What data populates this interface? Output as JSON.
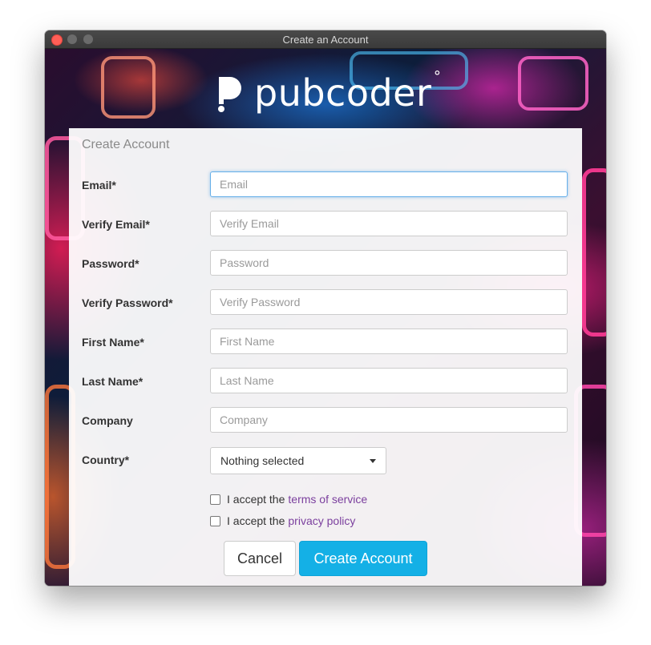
{
  "window": {
    "title": "Create an Account"
  },
  "logo": {
    "text": "pubcoder",
    "mark": "°"
  },
  "form": {
    "title": "Create Account",
    "fields": [
      {
        "label": "Email*",
        "placeholder": "Email"
      },
      {
        "label": "Verify Email*",
        "placeholder": "Verify Email"
      },
      {
        "label": "Password*",
        "placeholder": "Password"
      },
      {
        "label": "Verify Password*",
        "placeholder": "Verify Password"
      },
      {
        "label": "First Name*",
        "placeholder": "First Name"
      },
      {
        "label": "Last Name*",
        "placeholder": "Last Name"
      },
      {
        "label": "Company",
        "placeholder": "Company"
      }
    ],
    "country": {
      "label": "Country*",
      "selected": "Nothing selected"
    },
    "terms": {
      "prefix": "I accept the",
      "link": "terms of service",
      "checked": false
    },
    "privacy": {
      "prefix": "I accept the",
      "link": "privacy policy",
      "checked": false
    },
    "cancel_label": "Cancel",
    "create_label": "Create Account"
  },
  "colors": {
    "accent": "#14b0e6",
    "link": "#7b3f9e",
    "close_button": "#ff5f57"
  }
}
